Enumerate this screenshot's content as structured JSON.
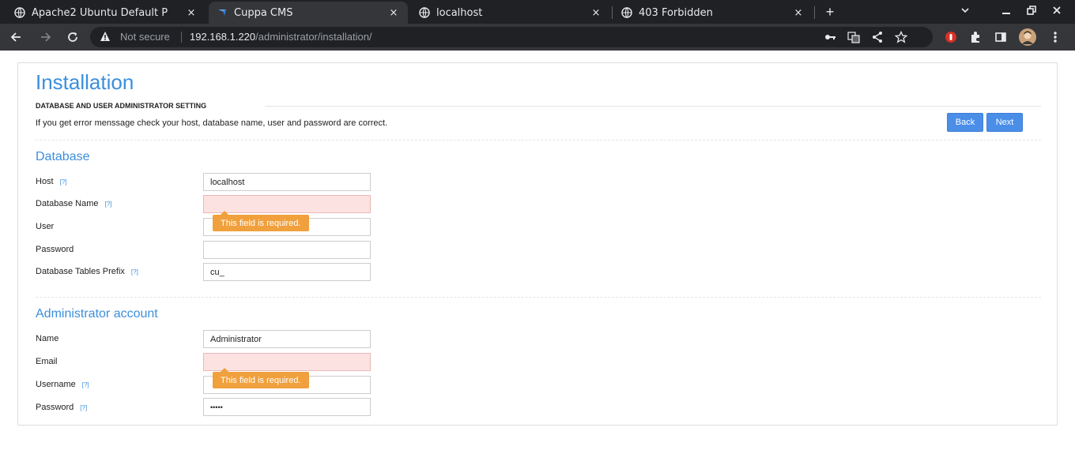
{
  "browser": {
    "tabs": [
      {
        "title": "Apache2 Ubuntu Default P",
        "icon": "globe-icon",
        "active": false
      },
      {
        "title": "Cuppa CMS",
        "icon": "cuppa-logo-icon",
        "active": true
      },
      {
        "title": "localhost",
        "icon": "globe-icon",
        "active": false
      },
      {
        "title": "403 Forbidden",
        "icon": "globe-icon",
        "active": false
      }
    ],
    "close_glyph": "×",
    "new_tab_glyph": "+",
    "address": {
      "security_label": "Not secure",
      "host": "192.168.1.220",
      "path": "/administrator/installation/"
    }
  },
  "page": {
    "title": "Installation",
    "section_label": "DATABASE AND USER ADMINISTRATOR SETTING",
    "help_text": "If you get error menssage check your host, database name, user and password are correct.",
    "buttons": {
      "back": "Back",
      "next": "Next"
    },
    "help_marker": "[?]",
    "database": {
      "title": "Database",
      "fields": [
        {
          "label": "Host",
          "value": "localhost",
          "help": true,
          "error": false
        },
        {
          "label": "Database Name",
          "value": "",
          "help": true,
          "error": true
        },
        {
          "label": "User",
          "value": "",
          "help": false,
          "error": false
        },
        {
          "label": "Password",
          "value": "",
          "help": false,
          "error": false
        },
        {
          "label": "Database Tables Prefix",
          "value": "cu_",
          "help": true,
          "error": false
        }
      ]
    },
    "admin": {
      "title": "Administrator account",
      "fields": [
        {
          "label": "Name",
          "value": "Administrator",
          "help": false,
          "error": false
        },
        {
          "label": "Email",
          "value": "",
          "help": false,
          "error": true
        },
        {
          "label": "Username",
          "value": "",
          "help": true,
          "error": false
        },
        {
          "label": "Password",
          "value": "•••••",
          "help": true,
          "error": false
        }
      ]
    },
    "error_message": "This field is required."
  },
  "colors": {
    "accent": "#3b8fdc",
    "button": "#4a8ee8",
    "tooltip": "#f0a03c",
    "error_bg": "#fde2e2"
  }
}
